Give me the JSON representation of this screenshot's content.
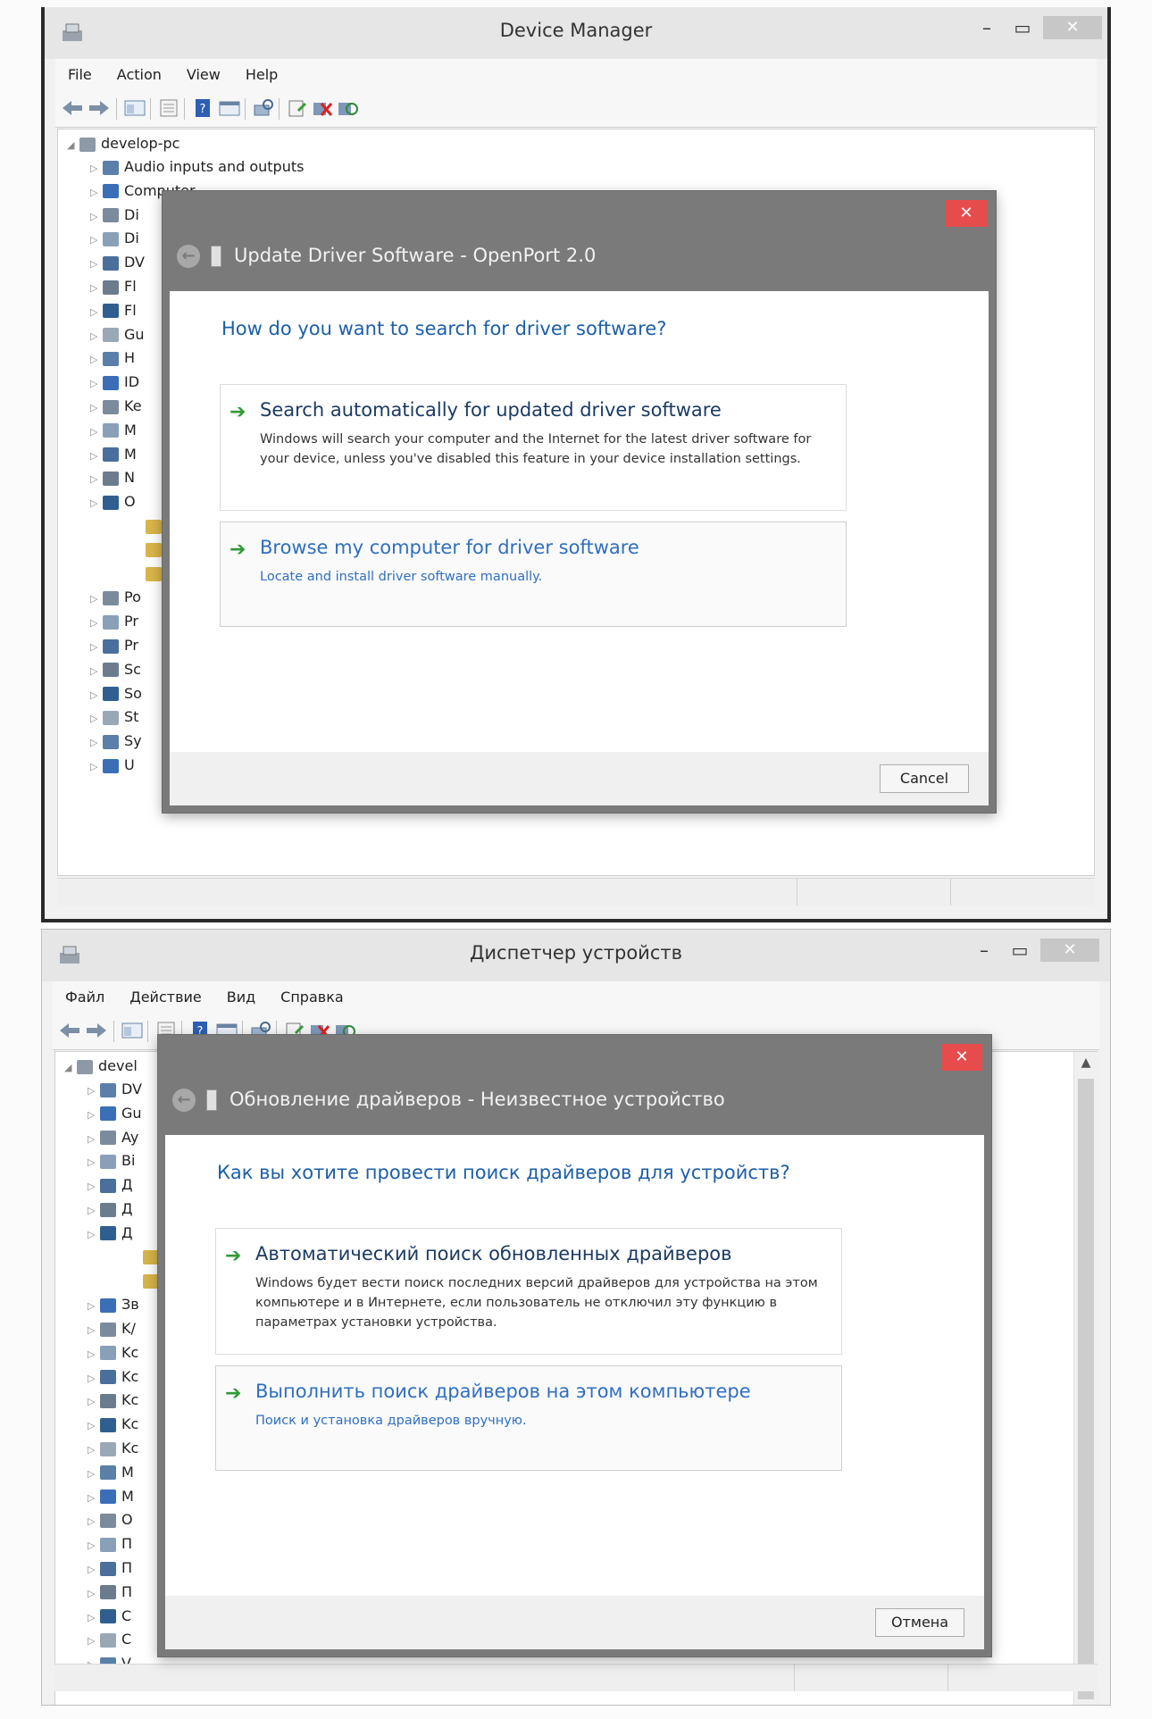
{
  "top": {
    "window_title": "Device Manager",
    "menu": [
      "File",
      "Action",
      "View",
      "Help"
    ],
    "tree": {
      "root": "develop-pc",
      "items": [
        "Audio inputs and outputs",
        "Computer",
        "Di",
        "Di",
        "DV",
        "Fl",
        "Fl",
        "Gu",
        "H",
        "ID",
        "Ke",
        "M",
        "M",
        "N",
        "O",
        "",
        "",
        "",
        "Po",
        "Pr",
        "Pr",
        "Sc",
        "So",
        "St",
        "Sy",
        "U"
      ]
    },
    "dialog": {
      "title": "Update Driver Software - OpenPort 2.0",
      "question": "How do you want to search for driver software?",
      "option1_title": "Search automatically for updated driver software",
      "option1_desc": "Windows will search your computer and the Internet for the latest driver software for your device, unless you've disabled this feature in your device installation settings.",
      "option2_title": "Browse my computer for driver software",
      "option2_desc": "Locate and install driver software manually.",
      "cancel": "Cancel"
    }
  },
  "bottom": {
    "window_title": "Диспетчер устройств",
    "menu": [
      "Файл",
      "Действие",
      "Вид",
      "Справка"
    ],
    "tree": {
      "root": "devel",
      "items": [
        "DV",
        "Gu",
        "Ay",
        "Bi",
        "Д",
        "Д",
        "Д",
        "",
        "",
        "Зв",
        "K/",
        "Kc",
        "Kc",
        "Kc",
        "Kc",
        "Kc",
        "M",
        "M",
        "O",
        "П",
        "П",
        "П",
        "C",
        "C",
        "V"
      ]
    },
    "dialog": {
      "title": "Обновление драйверов - Неизвестное устройство",
      "question": "Как вы хотите провести поиск драйверов для устройств?",
      "option1_title": "Автоматический поиск обновленных драйверов",
      "option1_desc": "Windows будет вести поиск последних версий драйверов для устройства на этом компьютере и в Интернете, если пользователь не отключил эту функцию в параметрах установки устройства.",
      "option2_title": "Выполнить поиск драйверов на этом компьютере",
      "option2_desc": "Поиск и установка драйверов вручную.",
      "cancel": "Отмена"
    }
  },
  "icons": [
    "app-icon",
    "back-arrow-icon",
    "forward-arrow-icon",
    "properties-icon",
    "help-icon",
    "scan-icon",
    "update-driver-icon",
    "uninstall-icon",
    "enable-icon"
  ],
  "colors": {
    "accent_blue": "#1c5fa8",
    "link_blue": "#2f6fc0",
    "arrow_green": "#2f9b35",
    "close_red": "#e74c4c",
    "dialog_frame": "#7a7a7a"
  }
}
